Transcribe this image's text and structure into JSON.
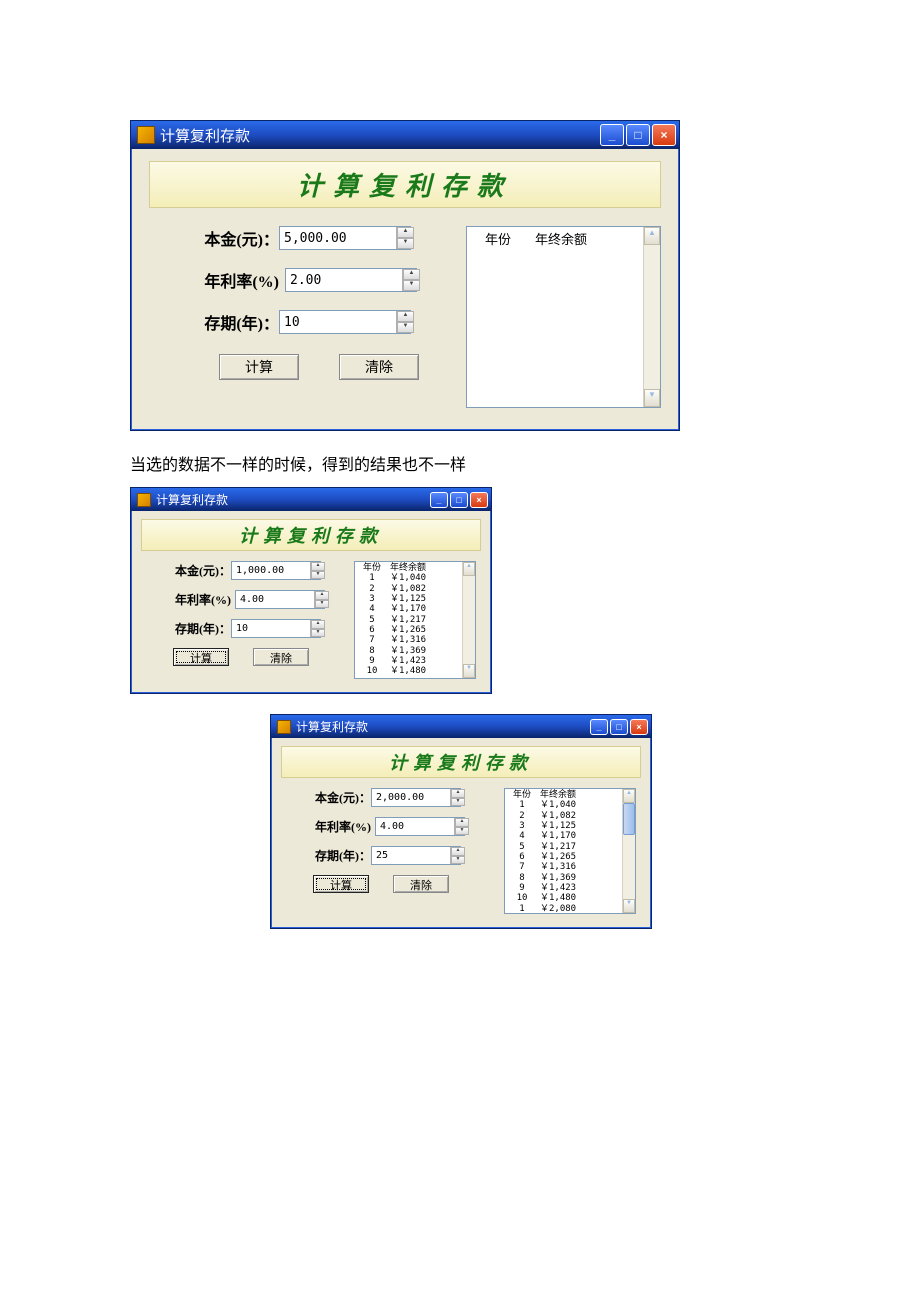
{
  "app_title": "计算复利存款",
  "heading": "计算复利存款",
  "labels": {
    "principal": "本金(元)：",
    "rate": "年利率(%)",
    "term": "存期(年)：",
    "calc": "计算",
    "clear": "清除",
    "col_year": "年份",
    "col_balance": "年终余额"
  },
  "caption": "当选的数据不一样的时候，得到的结果也不一样",
  "win1": {
    "principal": "5,000.00",
    "rate": "2.00",
    "term": "10",
    "results": []
  },
  "win2": {
    "principal": "1,000.00",
    "rate": "4.00",
    "term": "10",
    "results": [
      {
        "year": "1",
        "balance": "￥1,040"
      },
      {
        "year": "2",
        "balance": "￥1,082"
      },
      {
        "year": "3",
        "balance": "￥1,125"
      },
      {
        "year": "4",
        "balance": "￥1,170"
      },
      {
        "year": "5",
        "balance": "￥1,217"
      },
      {
        "year": "6",
        "balance": "￥1,265"
      },
      {
        "year": "7",
        "balance": "￥1,316"
      },
      {
        "year": "8",
        "balance": "￥1,369"
      },
      {
        "year": "9",
        "balance": "￥1,423"
      },
      {
        "year": "10",
        "balance": "￥1,480"
      }
    ]
  },
  "win3": {
    "principal": "2,000.00",
    "rate": "4.00",
    "term": "25",
    "results": [
      {
        "year": "1",
        "balance": "￥1,040"
      },
      {
        "year": "2",
        "balance": "￥1,082"
      },
      {
        "year": "3",
        "balance": "￥1,125"
      },
      {
        "year": "4",
        "balance": "￥1,170"
      },
      {
        "year": "5",
        "balance": "￥1,217"
      },
      {
        "year": "6",
        "balance": "￥1,265"
      },
      {
        "year": "7",
        "balance": "￥1,316"
      },
      {
        "year": "8",
        "balance": "￥1,369"
      },
      {
        "year": "9",
        "balance": "￥1,423"
      },
      {
        "year": "10",
        "balance": "￥1,480"
      },
      {
        "year": "1",
        "balance": "￥2,080"
      }
    ],
    "has_thumb": true
  }
}
